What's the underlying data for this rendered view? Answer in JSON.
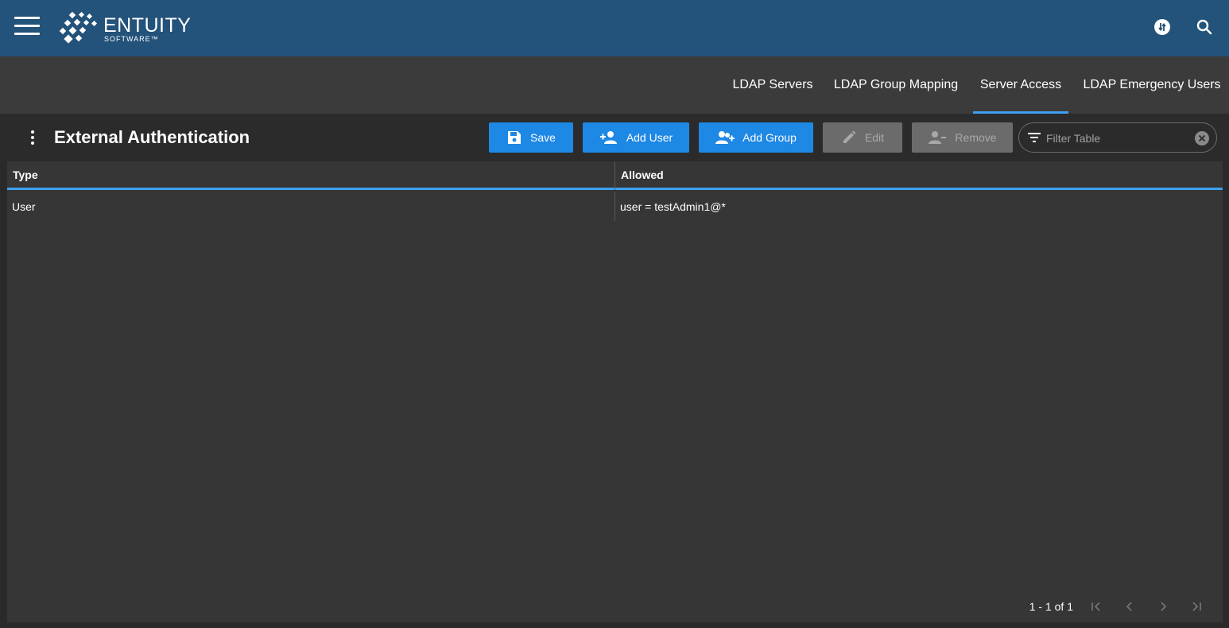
{
  "header": {
    "brand_name": "ENTUITY",
    "brand_sub": "SOFTWARE™",
    "icons": [
      "menu-icon",
      "sync-icon",
      "search-icon"
    ]
  },
  "tabs": [
    {
      "label": "LDAP Servers",
      "active": false
    },
    {
      "label": "LDAP Group Mapping",
      "active": false
    },
    {
      "label": "Server Access",
      "active": true
    },
    {
      "label": "LDAP Emergency Users",
      "active": false
    }
  ],
  "toolbar": {
    "title": "External Authentication",
    "save_label": "Save",
    "add_user_label": "Add User",
    "add_group_label": "Add Group",
    "edit_label": "Edit",
    "remove_label": "Remove",
    "filter_placeholder": "Filter Table"
  },
  "table": {
    "columns": [
      "Type",
      "Allowed"
    ],
    "rows": [
      [
        "User",
        "user = testAdmin1@*"
      ]
    ]
  },
  "pager": {
    "summary": "1 - 1 of 1"
  },
  "colors": {
    "header_bg": "#23527a",
    "accent": "#3ea0f0",
    "primary_button": "#1e88e5",
    "disabled_button": "#6b6b6b"
  }
}
